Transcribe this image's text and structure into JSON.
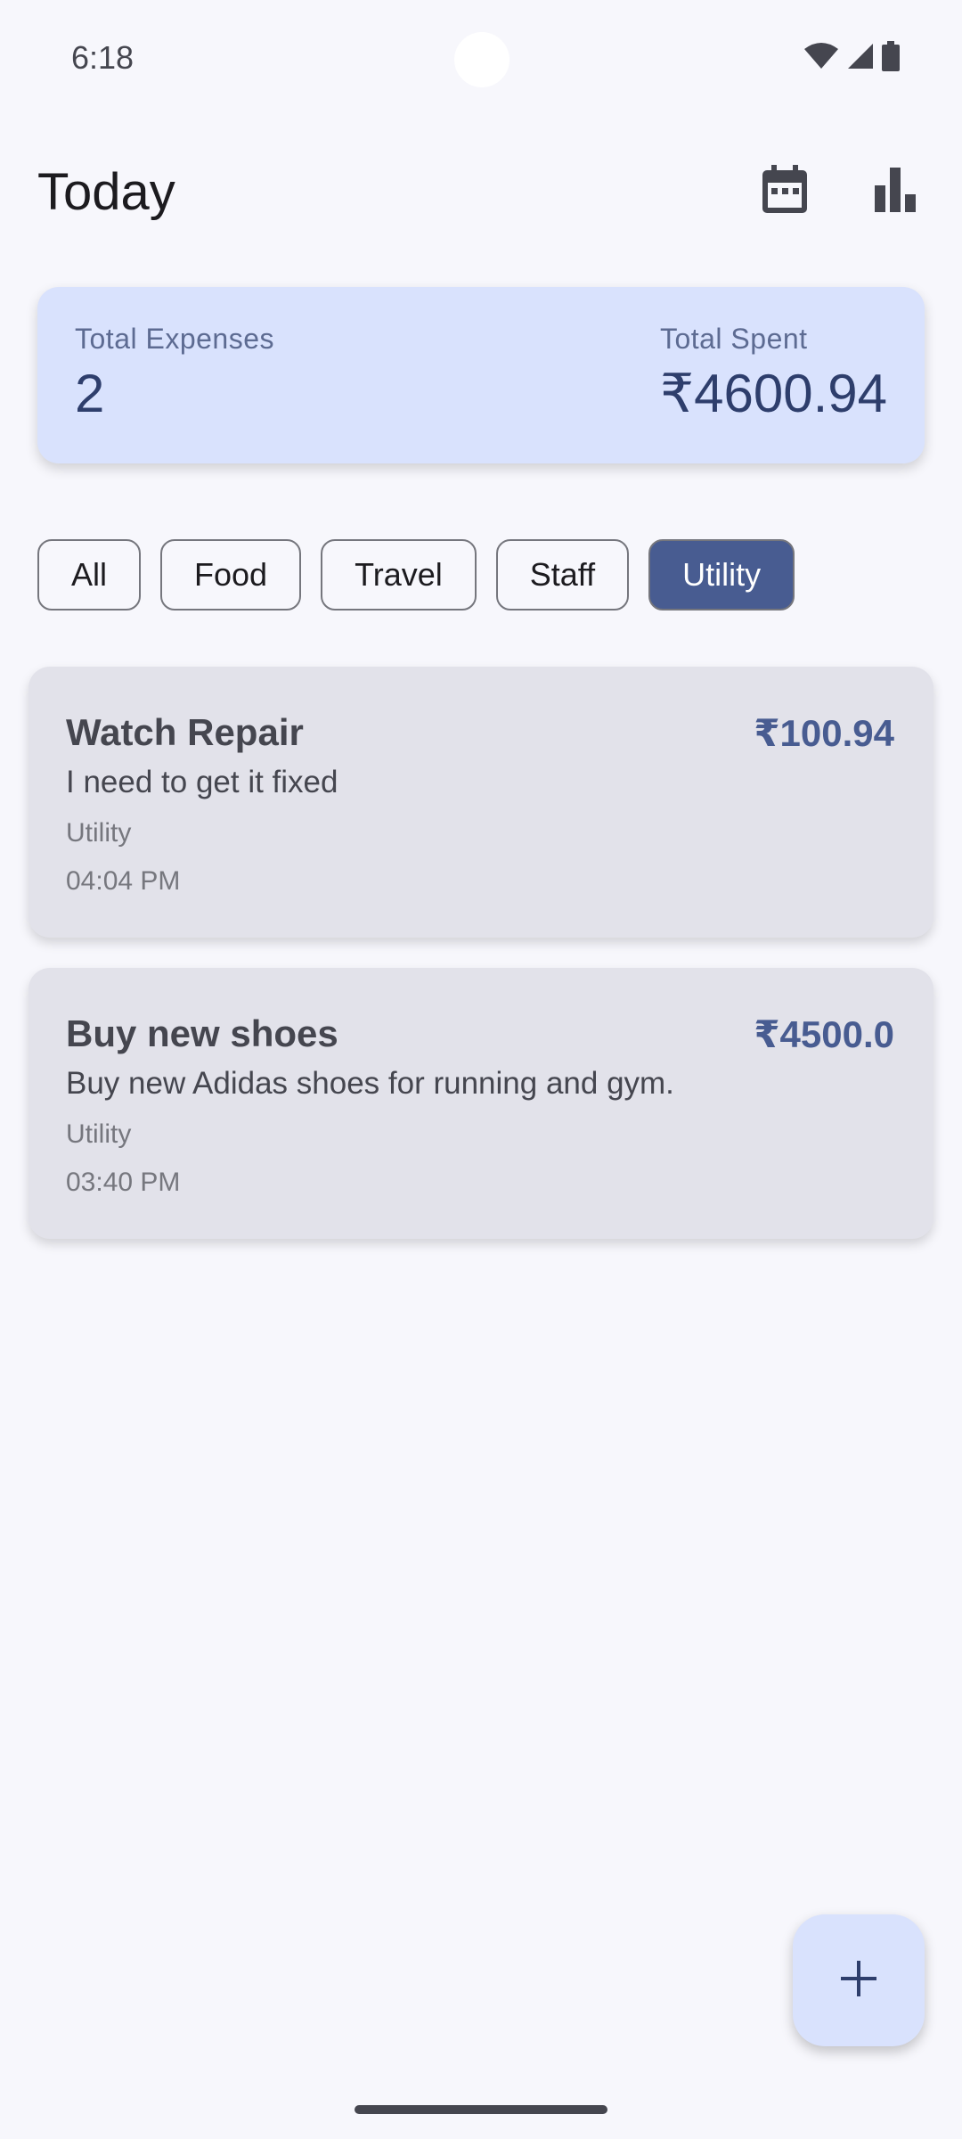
{
  "status_bar": {
    "time": "6:18",
    "icons": [
      "wifi-icon",
      "signal-icon",
      "battery-icon"
    ]
  },
  "app_bar": {
    "title": "Today",
    "actions": [
      "calendar-icon",
      "bar-chart-icon"
    ]
  },
  "summary": {
    "expenses_label": "Total Expenses",
    "expenses_value": "2",
    "spent_label": "Total Spent",
    "spent_value": "₹4600.94"
  },
  "filters": {
    "chips": [
      "All",
      "Food",
      "Travel",
      "Staff",
      "Utility"
    ],
    "selected": "Utility"
  },
  "expenses": [
    {
      "title": "Watch Repair",
      "amount": "₹100.94",
      "description": "I need to get it fixed",
      "category": "Utility",
      "time": "04:04 PM"
    },
    {
      "title": "Buy new shoes",
      "amount": "₹4500.0",
      "description": "Buy new Adidas shoes for running and gym.",
      "category": "Utility",
      "time": "03:40 PM"
    }
  ],
  "fab": {
    "icon": "plus-icon"
  },
  "colors": {
    "background": "#f7f7fc",
    "summary_card": "#d9e2fd",
    "accent": "#485c91",
    "expense_card": "#e2e2ea"
  }
}
